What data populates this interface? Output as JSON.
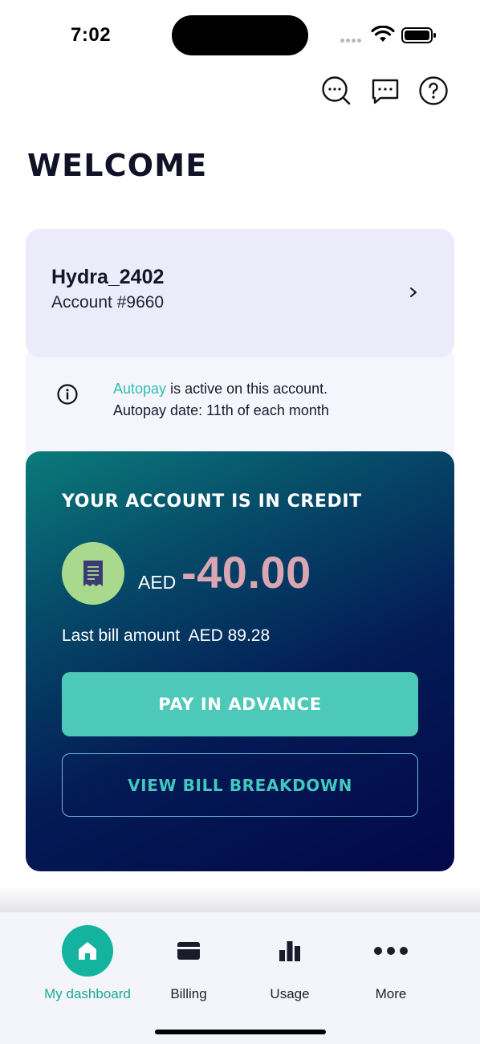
{
  "status_bar": {
    "time": "7:02",
    "icons": [
      "signal-icon",
      "wifi-icon",
      "battery-icon"
    ]
  },
  "top_actions": [
    {
      "name": "search-icon"
    },
    {
      "name": "chat-icon"
    },
    {
      "name": "help-icon"
    }
  ],
  "page": {
    "title": "WELCOME"
  },
  "account": {
    "name": "Hydra_2402",
    "number": "Account #9660"
  },
  "autopay": {
    "link_text": "Autopay",
    "line1_rest": " is active on this account.",
    "line2": "Autopay date: 11th of each month"
  },
  "credit": {
    "heading": "YOUR ACCOUNT IS IN CREDIT",
    "currency": "AED",
    "amount": "-40.00",
    "last_bill": "Last bill amount  AED 89.28",
    "pay_button": "PAY IN ADVANCE",
    "view_button": "VIEW BILL BREAKDOWN"
  },
  "bottom_nav": {
    "items": [
      {
        "label": "My dashboard",
        "icon": "home-icon",
        "active": true
      },
      {
        "label": "Billing",
        "icon": "card-icon",
        "active": false
      },
      {
        "label": "Usage",
        "icon": "bar-chart-icon",
        "active": false
      },
      {
        "label": "More",
        "icon": "more-icon",
        "active": false
      }
    ]
  },
  "colors": {
    "accent": "#14b39f",
    "button": "#4cc9b8",
    "amount": "#d9a6b1",
    "card_dark": "#03084a",
    "card_light": "#ecebfa",
    "bill_circle": "#a8d98c"
  }
}
